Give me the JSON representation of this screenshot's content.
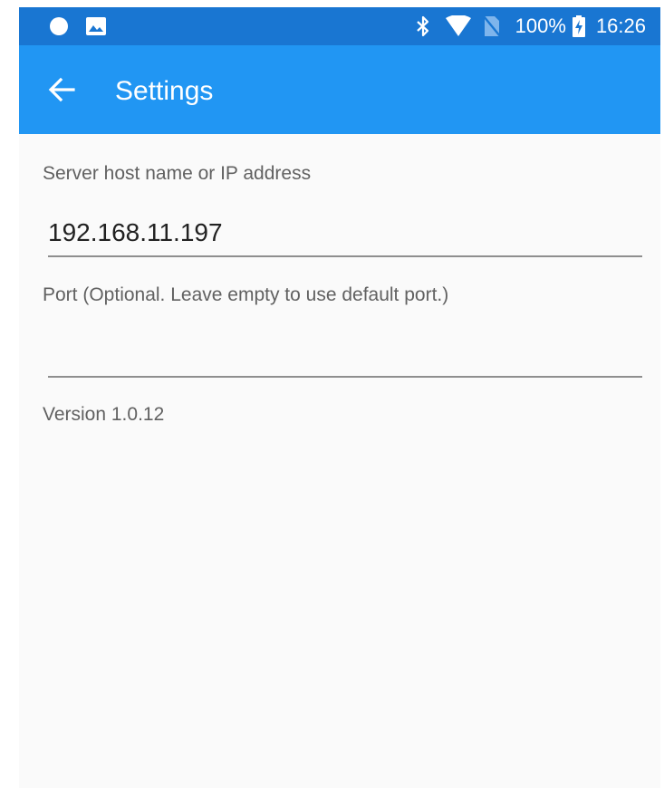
{
  "status_bar": {
    "battery_percent": "100%",
    "time": "16:26",
    "icons": [
      "notification-dot-icon",
      "image-icon",
      "bluetooth-icon",
      "wifi-icon",
      "no-sim-icon",
      "battery-charging-icon"
    ]
  },
  "app_bar": {
    "title": "Settings",
    "back_icon": "arrow-back-icon"
  },
  "settings": {
    "host_label": "Server host name or IP address",
    "host_value": "192.168.11.197",
    "port_label": "Port (Optional.  Leave empty to use default port.)",
    "port_value": "",
    "version": "Version 1.0.12"
  },
  "colors": {
    "status_bar": "#1976d2",
    "app_bar": "#2196f3",
    "background": "#fafafa"
  }
}
